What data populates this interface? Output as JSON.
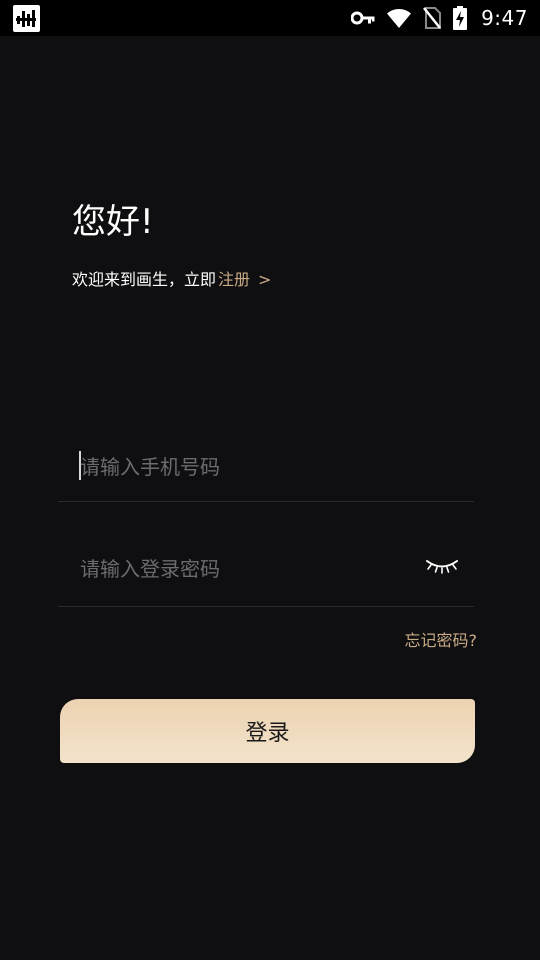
{
  "status_bar": {
    "time": "9:47",
    "icons": [
      "app-notification-icon",
      "vpn-key-icon",
      "wifi-icon",
      "no-sim-icon",
      "battery-charging-icon"
    ]
  },
  "greeting": {
    "title": "您好!",
    "welcome_text": "欢迎来到画生，立即",
    "register_link": "注册",
    "register_arrow": ">"
  },
  "form": {
    "phone_placeholder": "请输入手机号码",
    "phone_value": "",
    "password_placeholder": "请输入登录密码",
    "password_value": "",
    "forgot_password": "忘记密码?",
    "login_label": "登录"
  },
  "colors": {
    "background": "#0f0f11",
    "accent": "#c9ab86",
    "button_top": "#ecd2b1",
    "button_bottom": "#f3e3cb"
  }
}
